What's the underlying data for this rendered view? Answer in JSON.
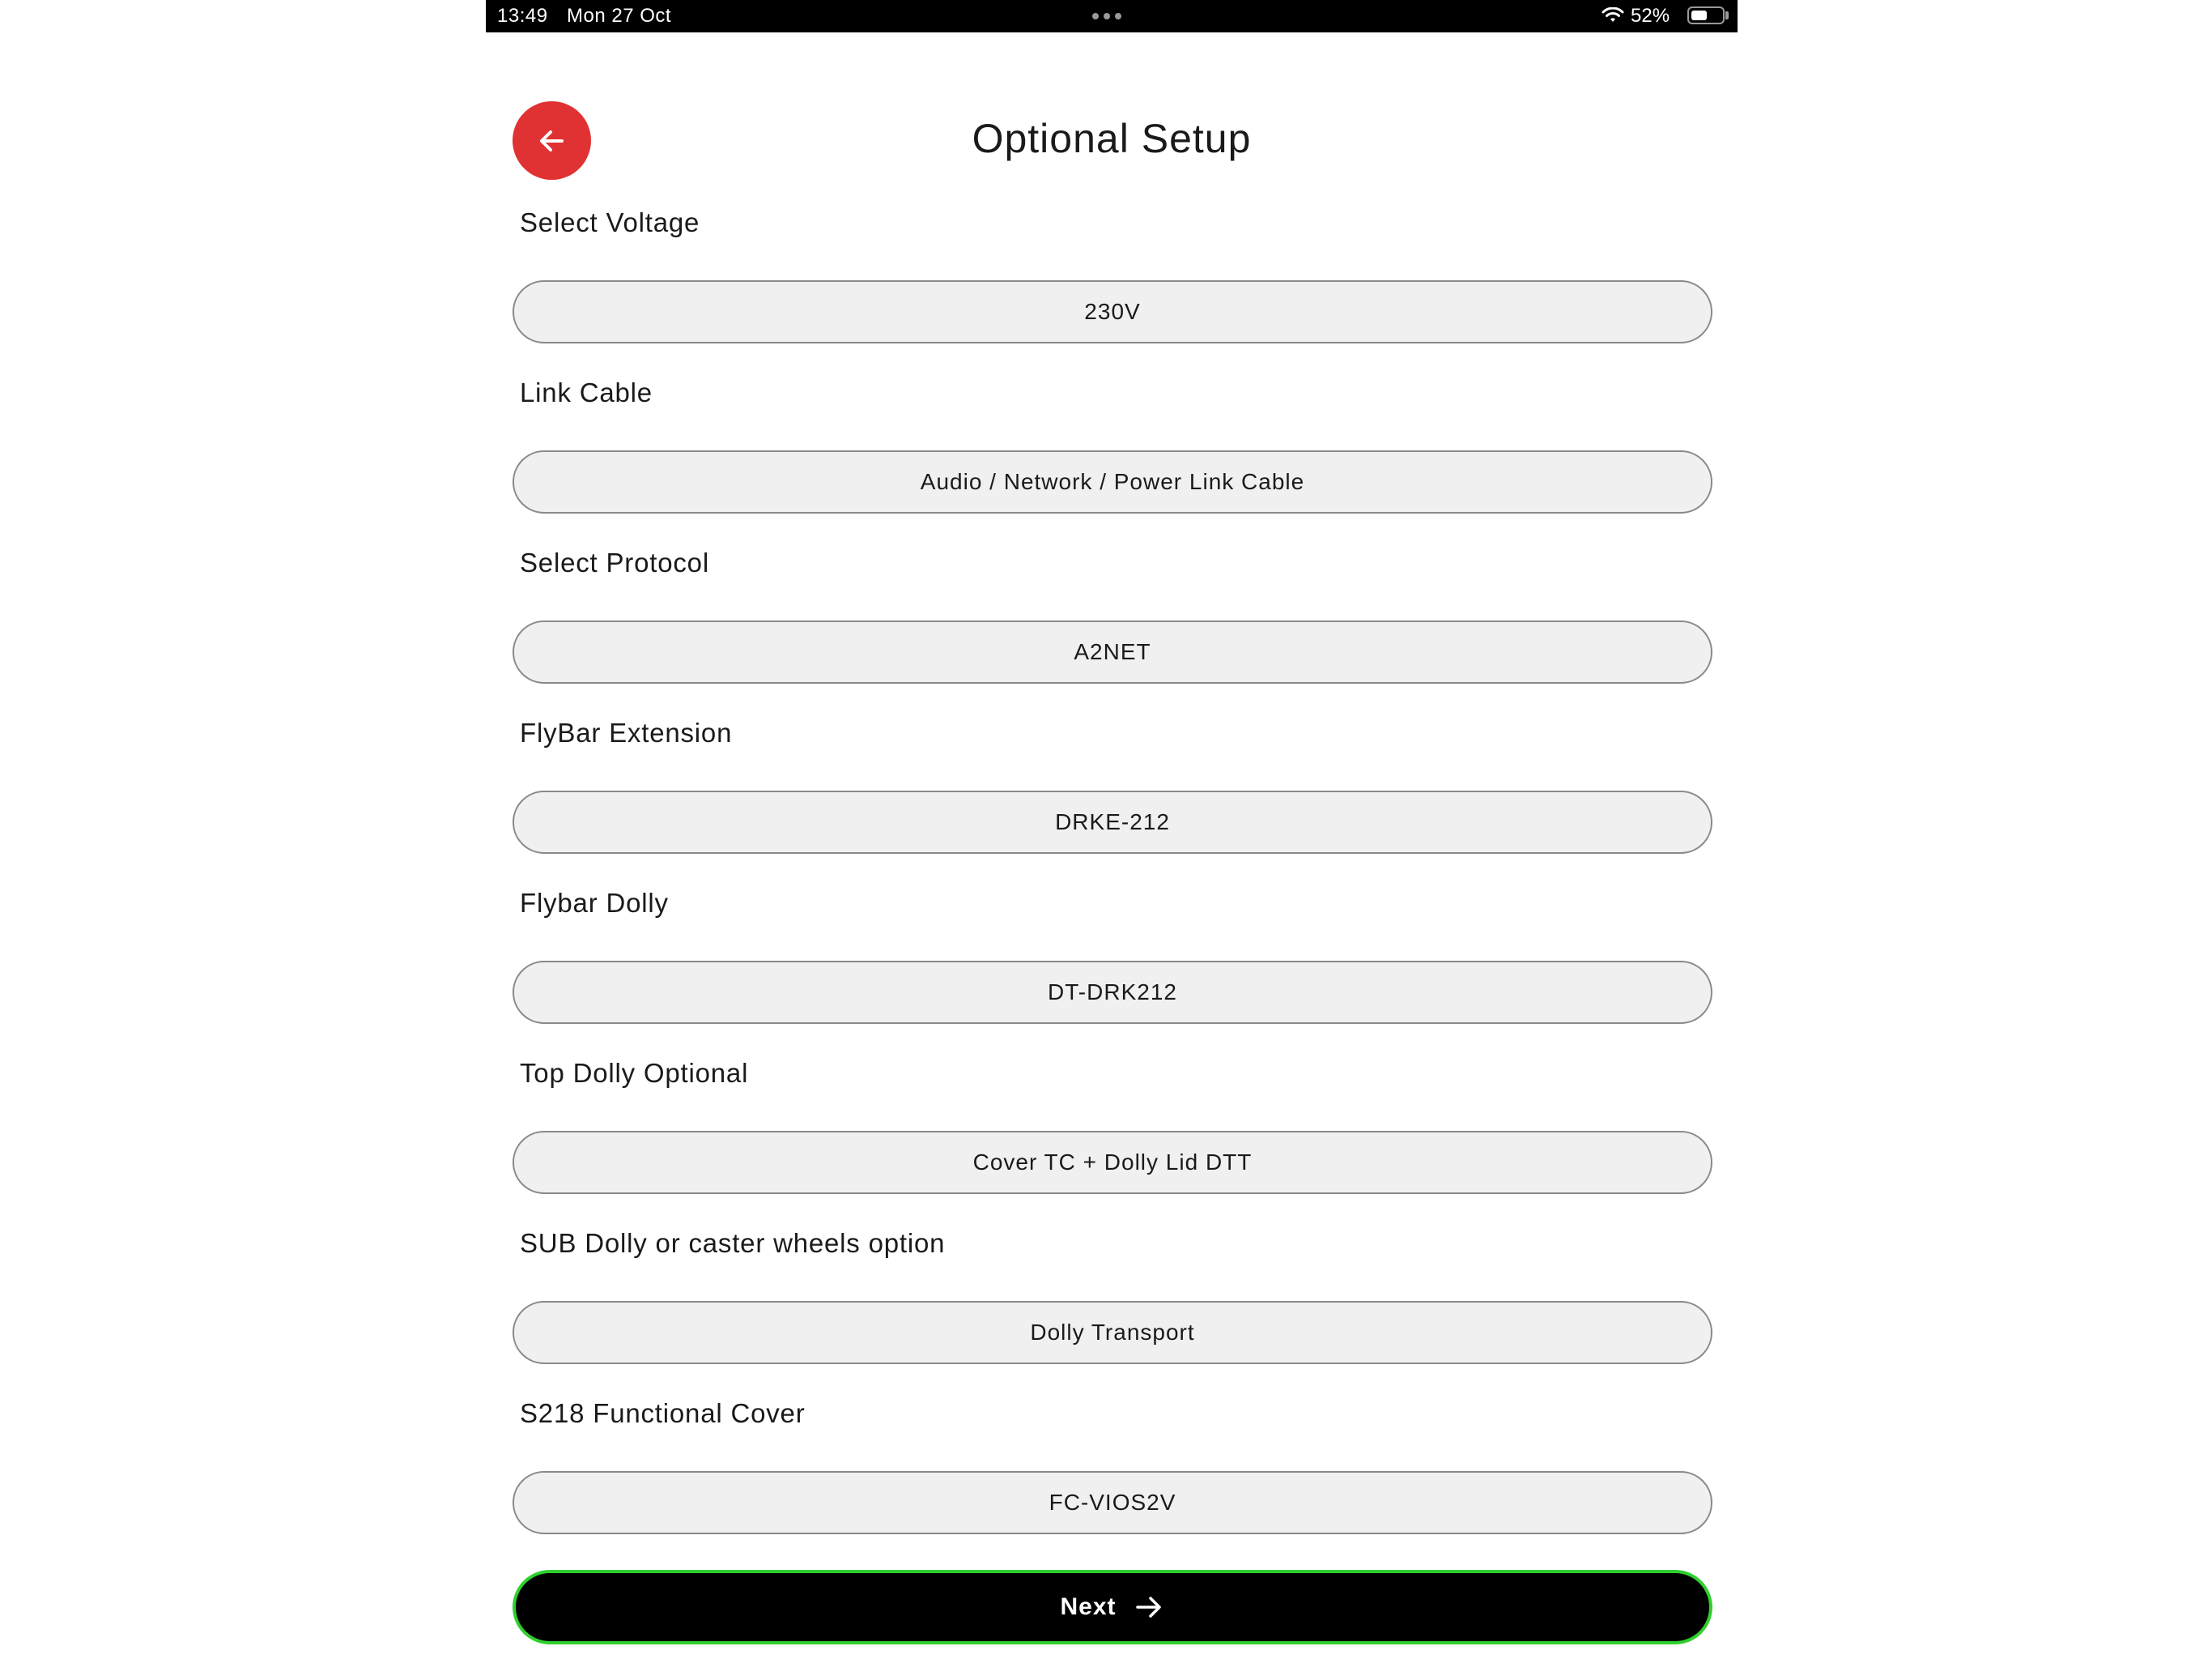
{
  "status_bar": {
    "time": "13:49",
    "date": "Mon 27 Oct",
    "battery": "52%",
    "battery_level": 0.52,
    "wifi_icon": "wifi-icon"
  },
  "header": {
    "back_icon": "arrow-left-icon",
    "title": "Optional Setup"
  },
  "colors": {
    "accent_red": "#e03232",
    "next_border_green": "#2fcf2f",
    "field_background": "#f0f0f0"
  },
  "fields": [
    {
      "label": "Select Voltage",
      "value": "230V"
    },
    {
      "label": "Link Cable",
      "value": "Audio / Network / Power Link Cable"
    },
    {
      "label": "Select Protocol",
      "value": "A2NET"
    },
    {
      "label": "FlyBar Extension",
      "value": "DRKE-212"
    },
    {
      "label": "Flybar Dolly",
      "value": "DT-DRK212"
    },
    {
      "label": "Top Dolly Optional",
      "value": "Cover TC + Dolly Lid DTT"
    },
    {
      "label": "SUB Dolly or caster wheels option",
      "value": "Dolly Transport"
    },
    {
      "label": "S218 Functional Cover",
      "value": "FC-VIOS2V"
    }
  ],
  "next": {
    "label": "Next",
    "icon": "arrow-right-icon"
  }
}
